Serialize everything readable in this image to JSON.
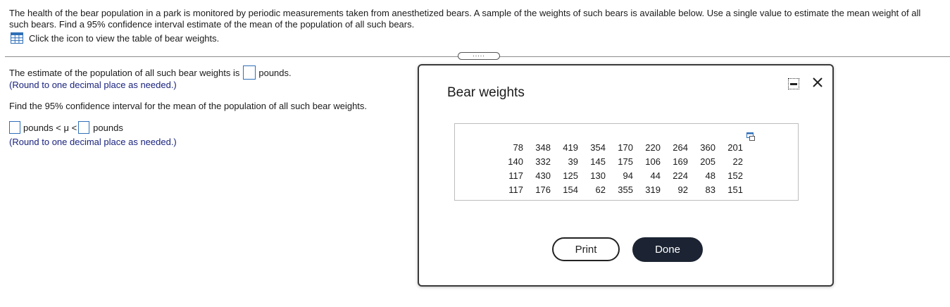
{
  "question": {
    "text": "The health of the bear population in a park is monitored by periodic measurements taken from anesthetized bears. A sample of the weights of such bears is available below. Use a single value to estimate the mean weight of all such bears. Find a 95% confidence interval estimate of the mean of the population of all such bears.",
    "table_link": "Click the icon to view the table of bear weights.",
    "table_icon": "table-grid-icon",
    "accent_color": "#2f6fb7"
  },
  "divider_handle": ".....",
  "part1": {
    "prefix": "The estimate of the population of all such bear weights is",
    "answer": "",
    "suffix": "pounds.",
    "hint": "(Round to one decimal place as needed.)"
  },
  "part2": {
    "prompt": "Find the 95% confidence interval for the mean of the population of all such bear weights.",
    "lower": "",
    "middle": "pounds < μ <",
    "upper": "",
    "suffix": "pounds",
    "hint": "(Round to one decimal place as needed.)"
  },
  "dialog": {
    "title": "Bear weights",
    "minimize_icon": "minimize-icon",
    "close_icon": "close-icon",
    "copy_icon": "copy-icon",
    "print_label": "Print",
    "done_label": "Done",
    "weights": [
      [
        78,
        348,
        419,
        354,
        170,
        220,
        264,
        360,
        201
      ],
      [
        140,
        332,
        39,
        145,
        175,
        106,
        169,
        205,
        22
      ],
      [
        117,
        430,
        125,
        130,
        94,
        44,
        224,
        48,
        152
      ],
      [
        117,
        176,
        154,
        62,
        355,
        319,
        92,
        83,
        151
      ]
    ]
  }
}
